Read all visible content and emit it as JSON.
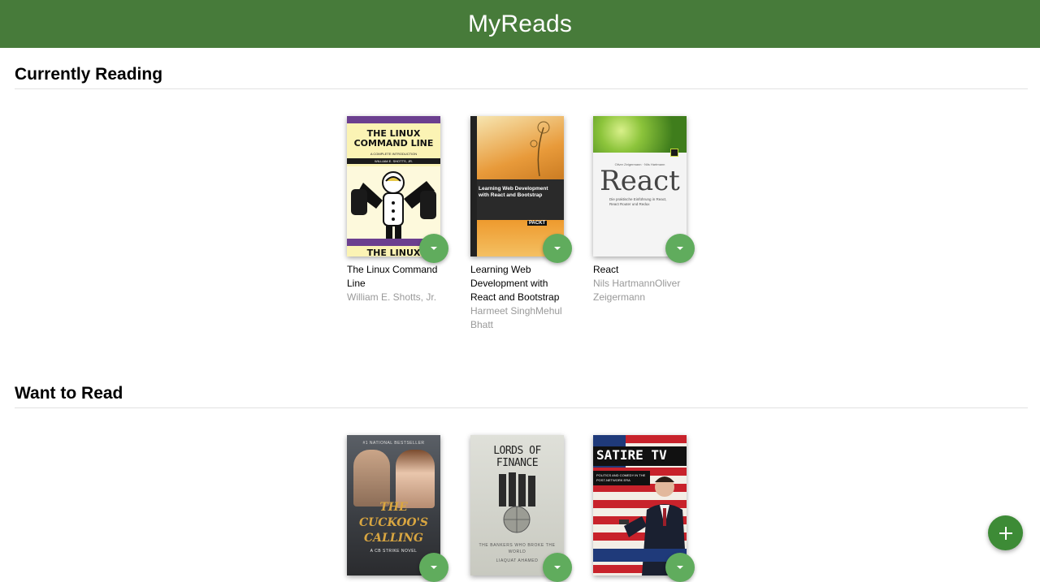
{
  "app": {
    "title": "MyReads"
  },
  "shelves": [
    {
      "title": "Currently Reading",
      "books": [
        {
          "title": "The Linux Command Line",
          "authors": "William E. Shotts, Jr.",
          "cover": {
            "line1": "THE LINUX",
            "line2": "COMMAND LINE",
            "subtitle": "A COMPLETE INTRODUCTION",
            "author": "WILLIAM E. SHOTTS, JR."
          }
        },
        {
          "title": "Learning Web Development with React and Bootstrap",
          "authors": "Harmeet SinghMehul Bhatt",
          "cover": {
            "title": "Learning Web Development with React and Bootstrap",
            "publisher": "PACKT"
          }
        },
        {
          "title": "React",
          "authors": "Nils HartmannOliver Zeigermann",
          "cover": {
            "authors": "Oliver Zeigermann · Nils Hartmann",
            "title": "React",
            "subtitle": "Die praktische Einführung in React, React Router und Redux"
          }
        }
      ]
    },
    {
      "title": "Want to Read",
      "books": [
        {
          "cover": {
            "top": "#1 NATIONAL BESTSELLER",
            "line1": "THE",
            "line2": "CUCKOO'S",
            "line3": "CALLING",
            "tag": "A CB STRIKE NOVEL"
          }
        },
        {
          "cover": {
            "title": "LORDS OF FINANCE",
            "subtitle": "THE BANKERS WHO BROKE THE WORLD",
            "author": "LIAQUAT AHAMED"
          }
        },
        {
          "cover": {
            "title": "SATIRE TV",
            "subtitle": "POLITICS AND COMEDY IN THE POST-NETWORK ERA"
          }
        }
      ]
    }
  ],
  "colors": {
    "header": "#477b3a",
    "shelf_changer": "#60ac5d",
    "add_button": "#3d8b36"
  },
  "icons": {
    "shelf_changer": "caret-down-icon",
    "add_button": "plus-icon"
  }
}
